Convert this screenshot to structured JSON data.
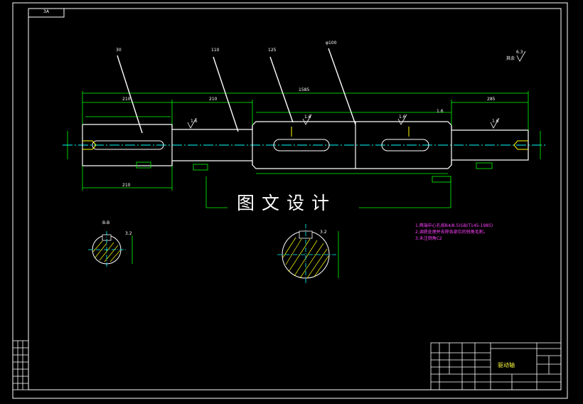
{
  "watermark": "图文设计",
  "frame_tab": "3A",
  "labels": {
    "leader_1": "30",
    "leader_2": "110",
    "leader_3": "125",
    "leader_4": "φ100",
    "rest_roughness": "其余",
    "rest_roughness_value": "6.3",
    "overall_length": "1585",
    "len_left": "210",
    "len_mid": "210",
    "len_right": "285",
    "roughness_left": "1.6",
    "roughness_mid_left": "1.6",
    "roughness_mid": "1.6",
    "roughness_mid_right": "1.6",
    "roughness_right": "1.6",
    "bottom_dim_left": "210",
    "section_label": "B-B",
    "section_roughness_1": "3.2",
    "section_roughness_2": "3.2"
  },
  "notes": [
    "1.两端中心孔按B4/8.5(GB/T145-1985)",
    "2.调质处理并去除各部位的锐角毛刺。",
    "3.未注倒角C2"
  ],
  "title_block": {
    "part_name": "驱动轴"
  }
}
